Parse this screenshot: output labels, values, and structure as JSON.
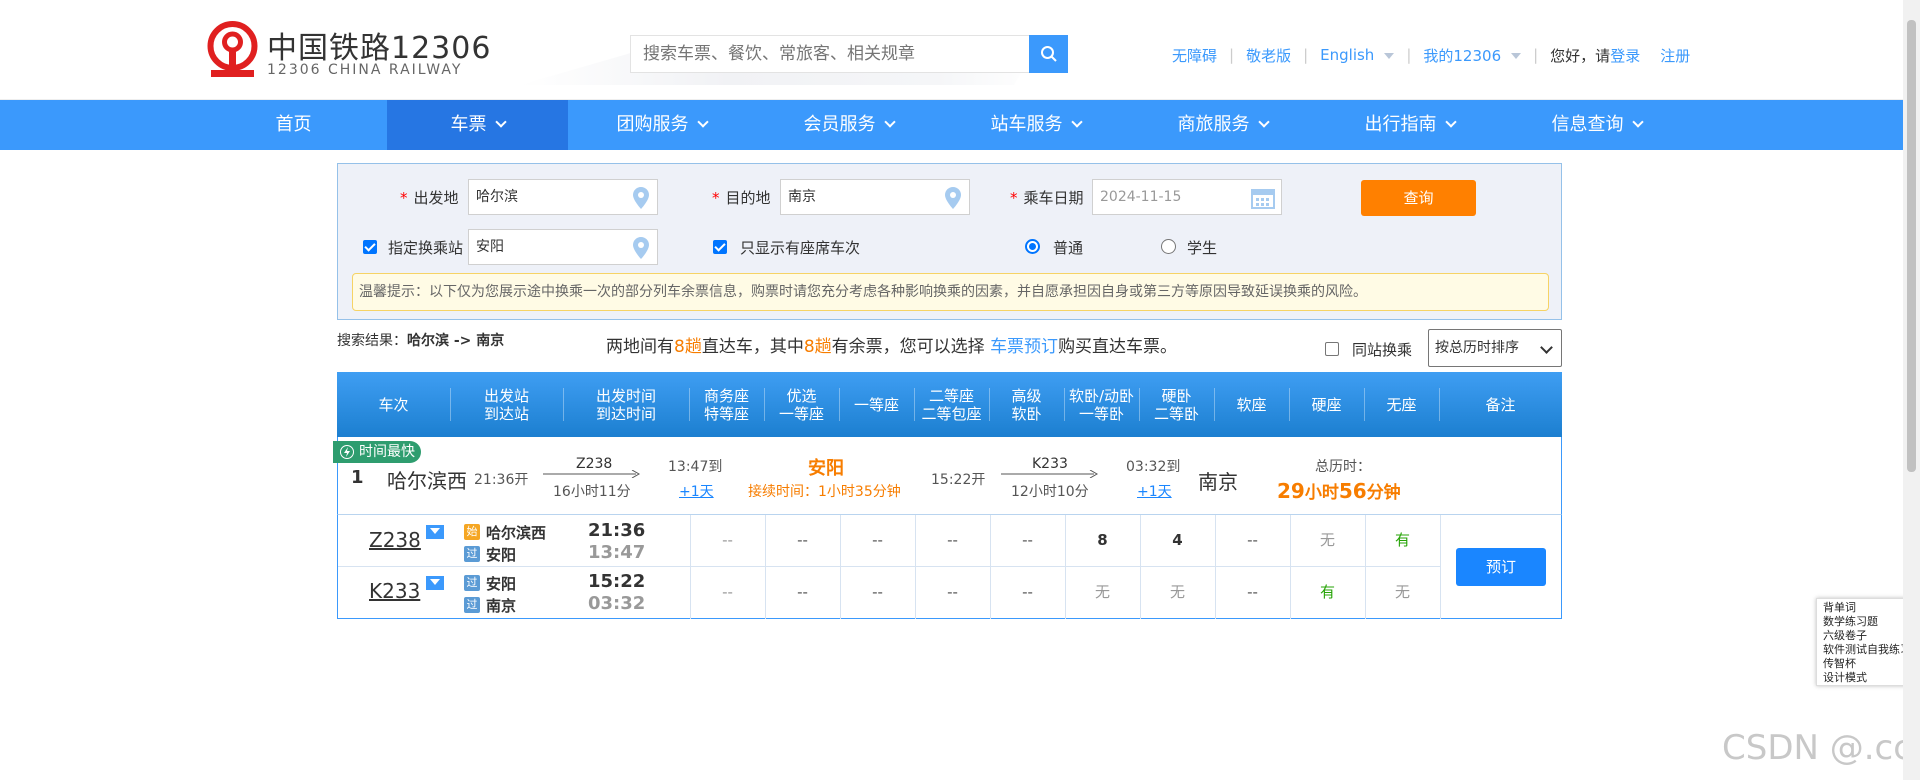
{
  "logo": {
    "cn": "中国铁路12306",
    "en": "12306 CHINA RAILWAY"
  },
  "search": {
    "placeholder": "搜索车票、餐饮、常旅客、相关规章"
  },
  "toplinks": {
    "accessible": "无障碍",
    "elder": "敬老版",
    "english": "English",
    "my12306": "我的12306",
    "greeting": "您好，请",
    "login": "登录",
    "register": "注册"
  },
  "nav": [
    {
      "label": "首页",
      "active": false
    },
    {
      "label": "车票",
      "active": true
    },
    {
      "label": "团购服务",
      "active": false
    },
    {
      "label": "会员服务",
      "active": false
    },
    {
      "label": "站车服务",
      "active": false
    },
    {
      "label": "商旅服务",
      "active": false
    },
    {
      "label": "出行指南",
      "active": false
    },
    {
      "label": "信息查询",
      "active": false
    }
  ],
  "query": {
    "from_label": "出发地",
    "from_value": "哈尔滨",
    "to_label": "目的地",
    "to_value": "南京",
    "date_label": "乘车日期",
    "date_value": "2024-11-15",
    "query_button": "查询",
    "transfer_label": "指定换乘站",
    "transfer_value": "安阳",
    "transfer_checked": true,
    "seat_only_label": "只显示有座席车次",
    "seat_only_checked": true,
    "normal_label": "普通",
    "student_label": "学生",
    "selected_type": "普通",
    "tip": "温馨提示：以下仅为您展示途中换乘一次的部分列车余票信息，购票时请您充分考虑各种影响换乘的因素，并自愿承担因自身或第三方等原因导致延误换乘的风险。"
  },
  "result": {
    "prefix": "搜索结果：",
    "route": "哈尔滨 -> 南京",
    "msg_1": "两地间有",
    "direct_count": "8趟",
    "msg_2": "直达车，其中",
    "avail_count": "8趟",
    "msg_3": "有余票，您可以选择 ",
    "link": "车票预订",
    "msg_4": "购买直达车票。",
    "same_station_label": "同站换乘",
    "sort_value": "按总历时排序"
  },
  "table_headers": [
    {
      "l1": "车次",
      "l2": ""
    },
    {
      "l1": "出发站",
      "l2": "到达站"
    },
    {
      "l1": "出发时间",
      "l2": "到达时间"
    },
    {
      "l1": "商务座",
      "l2": "特等座"
    },
    {
      "l1": "优选",
      "l2": "一等座"
    },
    {
      "l1": "一等座",
      "l2": ""
    },
    {
      "l1": "二等座",
      "l2": "二等包座"
    },
    {
      "l1": "高级",
      "l2": "软卧"
    },
    {
      "l1": "软卧/动卧",
      "l2": "一等卧"
    },
    {
      "l1": "硬卧",
      "l2": "二等卧"
    },
    {
      "l1": "软座",
      "l2": ""
    },
    {
      "l1": "硬座",
      "l2": ""
    },
    {
      "l1": "无座",
      "l2": ""
    },
    {
      "l1": "备注",
      "l2": ""
    }
  ],
  "summary": {
    "badge": "时间最快",
    "index": "1",
    "from_station": "哈尔滨西",
    "depart": "21:36开",
    "train1": "Z238",
    "dur1": "16小时11分",
    "arrive1": "13:47到",
    "plus1": "+1天",
    "transfer_station": "安阳",
    "transfer_time": "接续时间：1小时35分钟",
    "depart2": "15:22开",
    "train2": "K233",
    "dur2": "12小时10分",
    "arrive2": "03:32到",
    "plus2": "+1天",
    "to_station": "南京",
    "total_label": "总历时：",
    "total_h": "29",
    "total_h_unit": "小时",
    "total_m": "56",
    "total_m_unit": "分钟"
  },
  "rows": [
    {
      "train": "Z238",
      "st1_tag": "始",
      "st1": "哈尔滨西",
      "st2_tag": "过",
      "st2": "安阳",
      "t1": "21:36",
      "t2": "13:47",
      "seats": [
        "--",
        "--",
        "--",
        "--",
        "--",
        "8",
        "4",
        "--",
        "无",
        "有"
      ]
    },
    {
      "train": "K233",
      "st1_tag": "过",
      "st1": "安阳",
      "st2_tag": "过",
      "st2": "南京",
      "t1": "15:22",
      "t2": "03:32",
      "seats": [
        "--",
        "--",
        "--",
        "--",
        "--",
        "无",
        "无",
        "--",
        "有",
        "无"
      ]
    }
  ],
  "book_button": "预订",
  "side_popup": [
    "背单词",
    "数学练习题",
    "六级卷子",
    "软件测试自我练习",
    "传智杯",
    "设计模式"
  ],
  "watermark": "CSDN @.ccl",
  "colors": {
    "brand": "#3b99fc",
    "nav_active": "#2676e3",
    "query_button": "#ff8000",
    "book_button": "#1a86ff",
    "highlight": "#f77d00"
  }
}
